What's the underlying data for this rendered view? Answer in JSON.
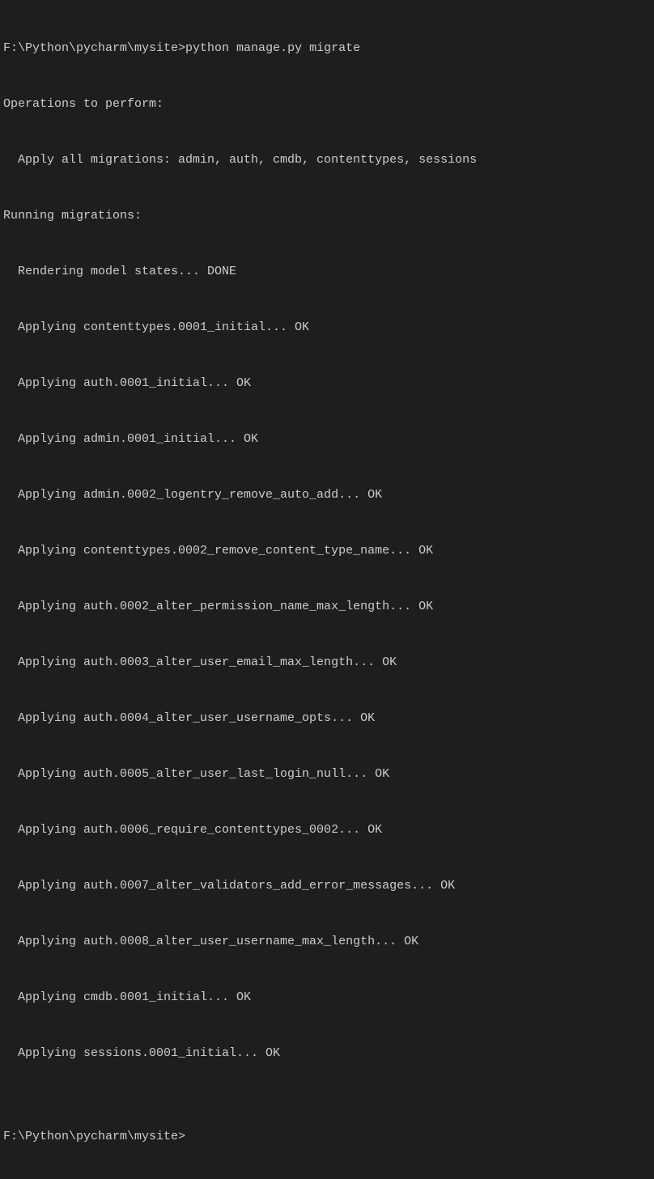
{
  "prompt1": {
    "path": "F:\\Python\\pycharm\\mysite>",
    "command": "python manage.py migrate"
  },
  "operations_header": "Operations to perform:",
  "apply_all": "Apply all migrations: admin, auth, cmdb, contenttypes, sessions",
  "running_header": "Running migrations:",
  "rendering": "Rendering model states... DONE",
  "migrations": [
    "Applying contenttypes.0001_initial... OK",
    "Applying auth.0001_initial... OK",
    "Applying admin.0001_initial... OK",
    "Applying admin.0002_logentry_remove_auto_add... OK",
    "Applying contenttypes.0002_remove_content_type_name... OK",
    "Applying auth.0002_alter_permission_name_max_length... OK",
    "Applying auth.0003_alter_user_email_max_length... OK",
    "Applying auth.0004_alter_user_username_opts... OK",
    "Applying auth.0005_alter_user_last_login_null... OK",
    "Applying auth.0006_require_contenttypes_0002... OK",
    "Applying auth.0007_alter_validators_add_error_messages... OK",
    "Applying auth.0008_alter_user_username_max_length... OK",
    "Applying cmdb.0001_initial... OK",
    "Applying sessions.0001_initial... OK"
  ],
  "prompt2": {
    "path": "F:\\Python\\pycharm\\mysite>"
  },
  "blank": ""
}
